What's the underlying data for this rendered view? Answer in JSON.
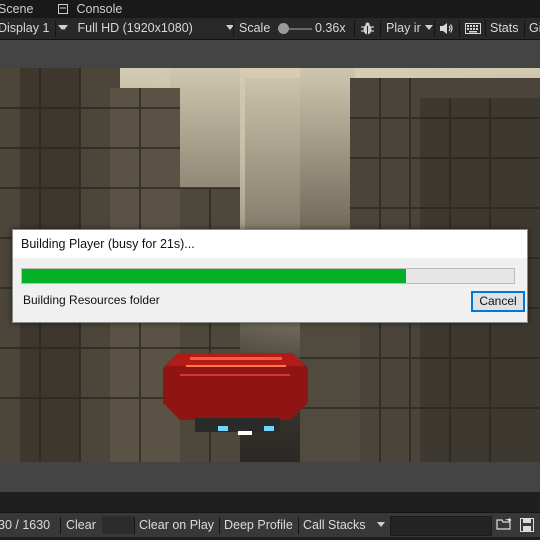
{
  "tabs": [
    {
      "label": "Scene"
    },
    {
      "label": "Console"
    }
  ],
  "toolbar": {
    "display": "Display 1",
    "resolution": "Full HD (1920x1080)",
    "scale_label": "Scale",
    "scale_value": "0.36x",
    "scale_fraction": 0.1,
    "play_mode": "Play ir",
    "stats": "Stats",
    "gizmos": "Gi"
  },
  "dialog": {
    "title": "Building Player (busy for 21s)...",
    "progress_fraction": 0.78,
    "status": "Building Resources folder",
    "cancel": "Cancel"
  },
  "console": {
    "count": "30 / 1630",
    "clear": "Clear",
    "clear_on_play": "Clear on Play",
    "deep_profile": "Deep Profile",
    "call_stacks": "Call Stacks"
  },
  "colors": {
    "progress_green": "#06b025",
    "editor_dark": "#282828",
    "accent_blue": "#0078d7"
  }
}
